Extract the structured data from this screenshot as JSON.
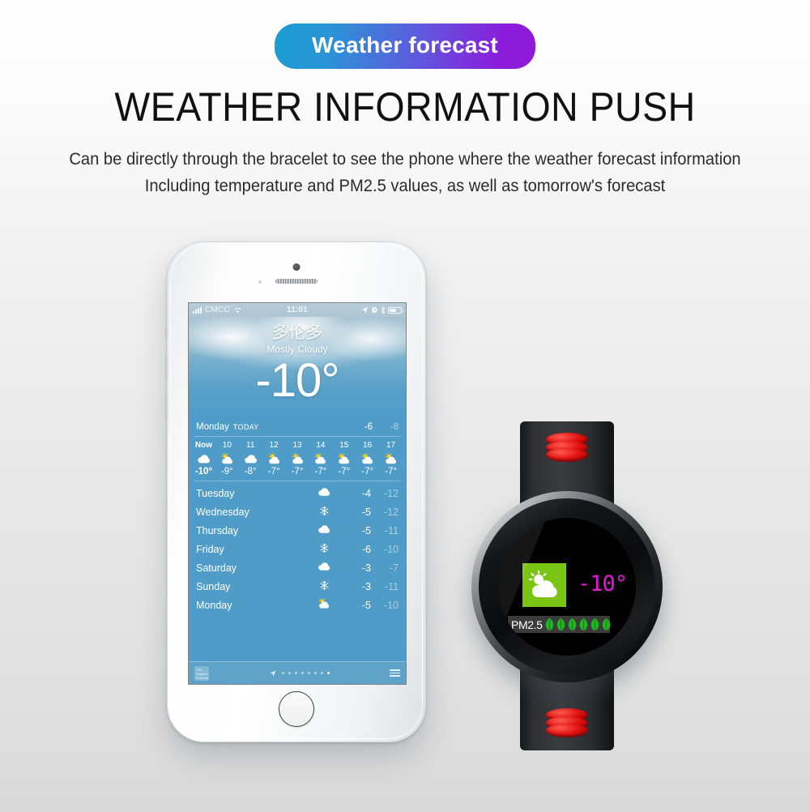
{
  "header": {
    "badge_label": "Weather forecast",
    "title": "WEATHER INFORMATION PUSH",
    "subtitle_line1": "Can be directly through the bracelet to see the phone where the weather forecast information",
    "subtitle_line2": "Including temperature and PM2.5 values, as well as tomorrow's forecast",
    "badge_gradient_start": "#1b9ed4",
    "badge_gradient_end": "#8b1cdb"
  },
  "phone": {
    "status_bar": {
      "carrier": "CMCC",
      "time": "11:01",
      "signal_icon": "signal-bars-icon",
      "wifi_icon": "wifi-icon",
      "location_icon": "location-arrow-icon",
      "alarm_icon": "alarm-clock-icon",
      "bluetooth_icon": "bluetooth-icon",
      "battery_icon": "battery-icon"
    },
    "weather": {
      "city": "多伦多",
      "condition": "Mostly Cloudy",
      "current_temp": "-10°",
      "today": {
        "day": "Monday",
        "label": "TODAY",
        "high": "-6",
        "low": "-8"
      },
      "hourly": [
        {
          "time": "Now",
          "icon": "cloud-icon",
          "temp": "-10°"
        },
        {
          "time": "10",
          "icon": "sun-cloud-icon",
          "temp": "-9°"
        },
        {
          "time": "11",
          "icon": "cloud-icon",
          "temp": "-8°"
        },
        {
          "time": "12",
          "icon": "sun-cloud-icon",
          "temp": "-7°"
        },
        {
          "time": "13",
          "icon": "sun-cloud-icon",
          "temp": "-7°"
        },
        {
          "time": "14",
          "icon": "sun-cloud-icon",
          "temp": "-7°"
        },
        {
          "time": "15",
          "icon": "sun-cloud-icon",
          "temp": "-7°"
        },
        {
          "time": "16",
          "icon": "sun-cloud-icon",
          "temp": "-7°"
        },
        {
          "time": "17",
          "icon": "sun-cloud-icon",
          "temp": "-7°"
        }
      ],
      "daily": [
        {
          "day": "Tuesday",
          "icon": "cloud-icon",
          "high": "-4",
          "low": "-12"
        },
        {
          "day": "Wednesday",
          "icon": "snowflake-icon",
          "high": "-5",
          "low": "-12"
        },
        {
          "day": "Thursday",
          "icon": "cloud-icon",
          "high": "-5",
          "low": "-11"
        },
        {
          "day": "Friday",
          "icon": "snowflake-icon",
          "high": "-6",
          "low": "-10"
        },
        {
          "day": "Saturday",
          "icon": "cloud-icon",
          "high": "-3",
          "low": "-7"
        },
        {
          "day": "Sunday",
          "icon": "snowflake-icon",
          "high": "-3",
          "low": "-11"
        },
        {
          "day": "Monday",
          "icon": "sun-cloud-icon",
          "high": "-5",
          "low": "-10"
        }
      ],
      "tab_bar": {
        "logo_text": "The Weather Channel",
        "page_count": 9,
        "active_page": 9,
        "location_icon": "location-arrow-icon",
        "list_icon": "list-icon"
      }
    }
  },
  "watch": {
    "weather_icon": "sun-cloud-icon",
    "weather_tile_color": "#7ac414",
    "temperature": "-10°",
    "temperature_color": "#e016d8",
    "pm_label": "PM2.5",
    "pm_leaf_count": 6,
    "pm_leaf_color": "#22b422",
    "strap_color": "#2e3034",
    "accent_color": "#e00f10"
  }
}
